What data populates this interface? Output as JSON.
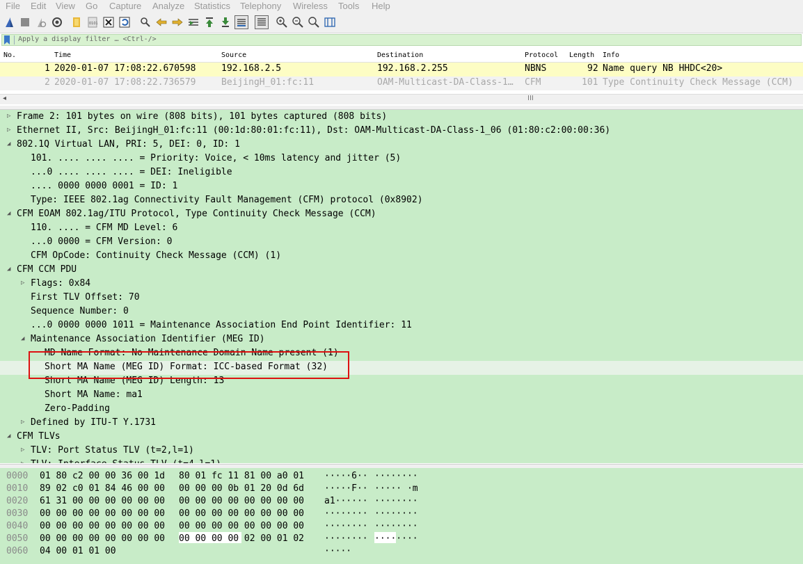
{
  "menu": [
    "File",
    "Edit",
    "View",
    "Go",
    "Capture",
    "Analyze",
    "Statistics",
    "Telephony",
    "Wireless",
    "Tools",
    "Help"
  ],
  "filter": {
    "placeholder": "Apply a display filter … <Ctrl-/>"
  },
  "packet_list": {
    "headers": [
      "No.",
      "Time",
      "Source",
      "Destination",
      "Protocol",
      "Length",
      "Info"
    ],
    "rows": [
      {
        "no": "1",
        "time": "2020-01-07 17:08:22.670598",
        "source": "192.168.2.5",
        "destination": "192.168.2.255",
        "protocol": "NBNS",
        "length": "92",
        "info": "Name query NB HHDC<20>"
      },
      {
        "no": "2",
        "time": "2020-01-07 17:08:22.736579",
        "source": "BeijingH_01:fc:11",
        "destination": "OAM-Multicast-DA-Class-1…",
        "protocol": "CFM",
        "length": "101",
        "info": "Type Continuity Check Message (CCM)"
      }
    ],
    "scroll_grip": "III"
  },
  "detail": [
    {
      "text": "Frame 2: 101 bytes on wire (808 bits), 101 bytes captured (808 bits)",
      "arrow": "collapsed"
    },
    {
      "text": "Ethernet II, Src: BeijingH_01:fc:11 (00:1d:80:01:fc:11), Dst: OAM-Multicast-DA-Class-1_06 (01:80:c2:00:00:36)",
      "arrow": "collapsed"
    },
    {
      "text": "802.1Q Virtual LAN, PRI: 5, DEI: 0, ID: 1",
      "arrow": "expanded"
    },
    {
      "text": "101. .... .... .... = Priority: Voice, < 10ms latency and jitter (5)"
    },
    {
      "text": "...0 .... .... .... = DEI: Ineligible"
    },
    {
      "text": ".... 0000 0000 0001 = ID: 1"
    },
    {
      "text": "Type: IEEE 802.1ag Connectivity Fault Management (CFM) protocol (0x8902)"
    },
    {
      "text": "CFM EOAM 802.1ag/ITU Protocol, Type Continuity Check Message (CCM)",
      "arrow": "expanded"
    },
    {
      "text": "110. .... = CFM MD Level: 6"
    },
    {
      "text": "...0 0000 = CFM Version: 0"
    },
    {
      "text": "CFM OpCode: Continuity Check Message (CCM) (1)"
    },
    {
      "text": "CFM CCM PDU",
      "arrow": "expanded"
    },
    {
      "text": "Flags: 0x84",
      "arrow": "collapsed"
    },
    {
      "text": "First TLV Offset: 70"
    },
    {
      "text": "Sequence Number: 0"
    },
    {
      "text": "...0 0000 0000 1011 = Maintenance Association End Point Identifier: 11"
    },
    {
      "text": "Maintenance Association Identifier (MEG ID)",
      "arrow": "expanded"
    },
    {
      "text": "MD Name Format: No Maintenance Domain Name present (1)"
    },
    {
      "text": "Short MA Name (MEG ID) Format: ICC-based Format (32)"
    },
    {
      "text": "Short MA Name (MEG ID) Length: 13"
    },
    {
      "text": "Short MA Name: ma1"
    },
    {
      "text": "Zero-Padding"
    },
    {
      "text": "Defined by ITU-T Y.1731",
      "arrow": "collapsed"
    },
    {
      "text": "CFM TLVs",
      "arrow": "expanded"
    },
    {
      "text": "TLV: Port Status TLV (t=2,l=1)",
      "arrow": "collapsed"
    },
    {
      "text": "TLV: Interface Status TLV (t=4,l=1)",
      "arrow": "collapsed"
    }
  ],
  "hex": [
    {
      "offset": "0000",
      "bytes1": "01 80 c2 00 00 36 00 1d",
      "bytes2": "80 01 fc 11 81 00 a0 01",
      "ascii1": "·····6··",
      "ascii2": "········"
    },
    {
      "offset": "0010",
      "bytes1": "89 02 c0 01 84 46 00 00",
      "bytes2": "00 00 00 0b 01 20 0d 6d",
      "ascii1": "·····F··",
      "ascii2": "····· ·m"
    },
    {
      "offset": "0020",
      "bytes1": "61 31 00 00 00 00 00 00",
      "bytes2": "00 00 00 00 00 00 00 00",
      "ascii1": "a1······",
      "ascii2": "········"
    },
    {
      "offset": "0030",
      "bytes1": "00 00 00 00 00 00 00 00",
      "bytes2": "00 00 00 00 00 00 00 00",
      "ascii1": "········",
      "ascii2": "········"
    },
    {
      "offset": "0040",
      "bytes1": "00 00 00 00 00 00 00 00",
      "bytes2": "00 00 00 00 00 00 00 00",
      "ascii1": "········",
      "ascii2": "········"
    },
    {
      "offset": "0050",
      "bytes1": "00 00 00 00 00 00 00 00",
      "bytes2": "00 00 00 00 02 00 01 02",
      "ascii1": "········",
      "ascii2": "········"
    },
    {
      "offset": "0060",
      "bytes1": "04 00 01 01 00",
      "bytes2": "",
      "ascii1": "·····",
      "ascii2": ""
    }
  ],
  "colors": {
    "detail_bg": "#c8ecc8",
    "selected_row_bg": "#fdfdc4",
    "annotation_box": "#dd1111",
    "filter_bg": "#d8f2d0"
  },
  "icons": [
    "shark-fin-start-icon",
    "stop-icon",
    "restart-icon",
    "options-gear-icon",
    "open-folder-icon",
    "save-file-icon",
    "close-file-icon",
    "reload-icon",
    "find-icon",
    "back-arrow-icon",
    "forward-arrow-icon",
    "go-to-packet-icon",
    "first-packet-icon",
    "last-packet-icon",
    "autoscroll-icon",
    "colorize-icon",
    "zoom-in-icon",
    "zoom-out-icon",
    "normal-size-icon",
    "resize-columns-icon"
  ]
}
